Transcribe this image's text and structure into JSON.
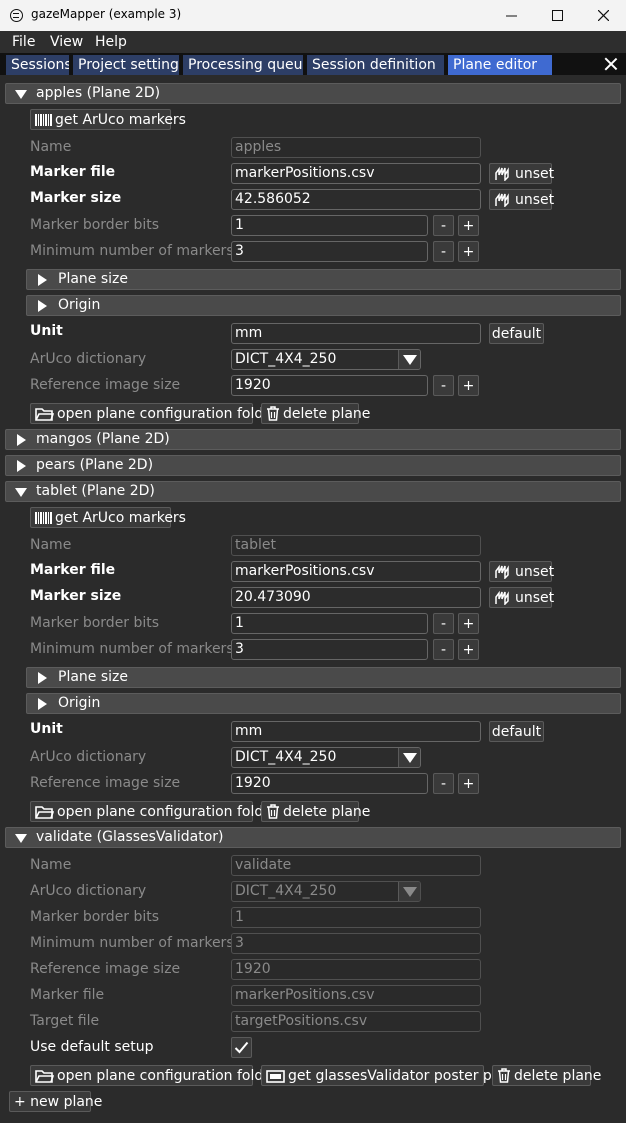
{
  "window": {
    "title": "gazeMapper (example 3)"
  },
  "menu": [
    "File",
    "View",
    "Help"
  ],
  "tabs": [
    "Sessions",
    "Project settings",
    "Processing queue",
    "Session definition",
    "Plane editor"
  ],
  "planes": {
    "apples": {
      "header": "apples (Plane 2D)",
      "get_markers": "get ArUco markers",
      "name_label": "Name",
      "name_value": "apples",
      "marker_file_label": "Marker file",
      "marker_file_value": "markerPositions.csv",
      "marker_size_label": "Marker size",
      "marker_size_value": "42.586052",
      "border_bits_label": "Marker border bits",
      "border_bits_value": "1",
      "min_markers_label": "Minimum number of markers",
      "min_markers_value": "3",
      "plane_size": "Plane size",
      "origin": "Origin",
      "unit_label": "Unit",
      "unit_value": "mm",
      "dict_label": "ArUco dictionary",
      "dict_value": "DICT_4X4_250",
      "ref_size_label": "Reference image size",
      "ref_size_value": "1920",
      "open_folder": "open plane configuration folder",
      "delete": "delete plane"
    },
    "mangos": {
      "header": "mangos (Plane 2D)"
    },
    "pears": {
      "header": "pears (Plane 2D)"
    },
    "tablet": {
      "header": "tablet (Plane 2D)",
      "get_markers": "get ArUco markers",
      "name_label": "Name",
      "name_value": "tablet",
      "marker_file_label": "Marker file",
      "marker_file_value": "markerPositions.csv",
      "marker_size_label": "Marker size",
      "marker_size_value": "20.473090",
      "border_bits_label": "Marker border bits",
      "border_bits_value": "1",
      "min_markers_label": "Minimum number of markers",
      "min_markers_value": "3",
      "plane_size": "Plane size",
      "origin": "Origin",
      "unit_label": "Unit",
      "unit_value": "mm",
      "dict_label": "ArUco dictionary",
      "dict_value": "DICT_4X4_250",
      "ref_size_label": "Reference image size",
      "ref_size_value": "1920",
      "open_folder": "open plane configuration folder",
      "delete": "delete plane"
    },
    "validate": {
      "header": "validate (GlassesValidator)",
      "name_label": "Name",
      "name_value": "validate",
      "dict_label": "ArUco dictionary",
      "dict_value": "DICT_4X4_250",
      "border_bits_label": "Marker border bits",
      "border_bits_value": "1",
      "min_markers_label": "Minimum number of markers",
      "min_markers_value": "3",
      "ref_size_label": "Reference image size",
      "ref_size_value": "1920",
      "marker_file_label": "Marker file",
      "marker_file_value": "markerPositions.csv",
      "target_file_label": "Target file",
      "target_file_value": "targetPositions.csv",
      "default_setup_label": "Use default setup",
      "default_setup_checked": true,
      "open_folder": "open plane configuration folder",
      "poster": "get glassesValidator poster pdf",
      "delete": "delete plane"
    }
  },
  "common": {
    "unset": "unset",
    "default": "default",
    "minus": "-",
    "plus": "+"
  },
  "new_plane": "+ new plane"
}
